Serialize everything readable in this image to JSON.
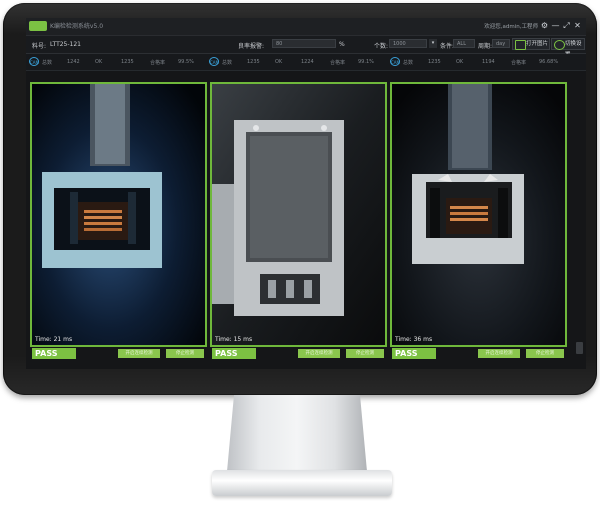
{
  "app": {
    "title": "K编检检测系统v5.0",
    "user": "欢迎您,admin,工程师"
  },
  "titlebar_icons": [
    "settings-icon",
    "minimize-icon",
    "restore-icon",
    "close-icon"
  ],
  "toolbar": {
    "part_label": "料号:",
    "part_value": "LTT25-121",
    "rate_label": "良率报警:",
    "rate_value": "80",
    "rate_unit": "%",
    "count_label": "个数:",
    "count_value": "1000",
    "filter_label": "条件:",
    "filter_value": "ALL",
    "period_label": "周期:",
    "period_value": "day",
    "open_image_label": "打开图片",
    "switch_settings_label": "切换设置"
  },
  "stats": [
    {
      "cam": "CAM",
      "total_label": "总数",
      "total": "1242",
      "ok_label": "OK",
      "ok": "1235",
      "rate_label": "合格率",
      "rate": "99.5%"
    },
    {
      "cam": "CAM",
      "total_label": "总数",
      "total": "1235",
      "ok_label": "OK",
      "ok": "1224",
      "rate_label": "合格率",
      "rate": "99.1%"
    },
    {
      "cam": "CAM",
      "total_label": "总数",
      "total": "1235",
      "ok_label": "OK",
      "ok": "1194",
      "rate_label": "合格率",
      "rate": "96.68%"
    }
  ],
  "panels": [
    {
      "time": "Time: 21 ms",
      "status": "PASS",
      "btn1": "开启连续检测",
      "btn2": "停止检测"
    },
    {
      "time": "Time: 15 ms",
      "status": "PASS",
      "btn1": "开启连续检测",
      "btn2": "停止检测"
    },
    {
      "time": "Time: 36 ms",
      "status": "PASS",
      "btn1": "开启连续检测",
      "btn2": "停止检测"
    }
  ],
  "colors": {
    "accent": "#7cc142",
    "frame": "#6fb83b",
    "bezel": "#1b1b1b",
    "camera_icon": "#3aa0d8"
  }
}
